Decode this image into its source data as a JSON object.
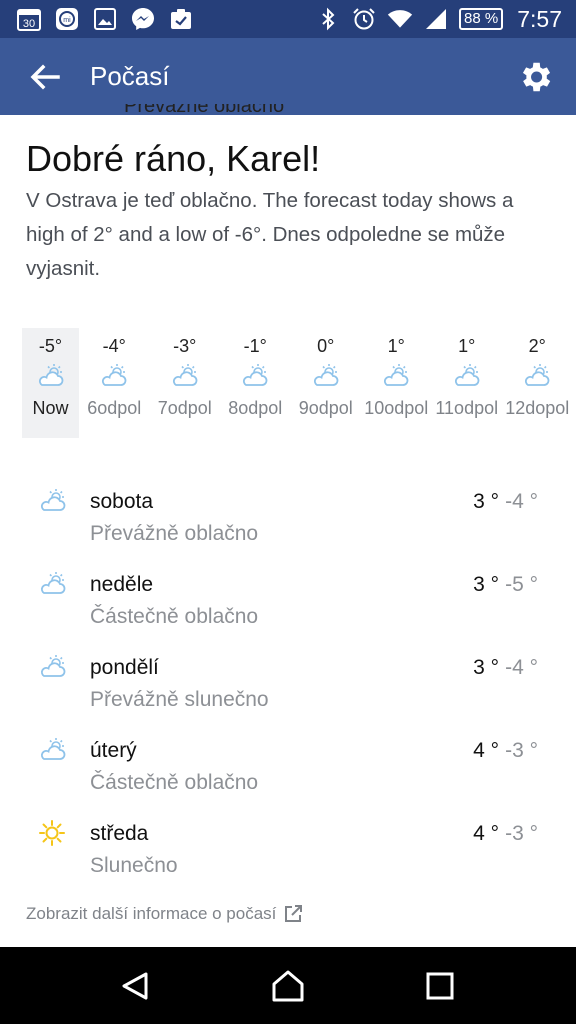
{
  "status_bar": {
    "notification_icons": [
      "calendar-30-icon",
      "mi-fit-icon",
      "gallery-icon",
      "messenger-icon",
      "tasks-icon"
    ],
    "calendar_day": "30",
    "right_icons": [
      "bluetooth-icon",
      "alarm-icon",
      "wifi-icon",
      "signal-icon"
    ],
    "battery": "88 %",
    "time": "7:57"
  },
  "app_bar": {
    "title": "Počasí",
    "color": "#3b5998"
  },
  "cut_off_text": "Převážně oblačno",
  "greeting": "Dobré ráno, Karel!",
  "summary": "V Ostrava je teď oblačno. The forecast today shows a high of 2° and a low of -6°. Dnes odpoledne se může vyjasnit.",
  "hourly": [
    {
      "temp": "-5°",
      "label": "Now",
      "icon": "partly-cloudy-icon"
    },
    {
      "temp": "-4°",
      "label": "6odpol",
      "icon": "partly-cloudy-icon"
    },
    {
      "temp": "-3°",
      "label": "7odpol",
      "icon": "partly-cloudy-icon"
    },
    {
      "temp": "-1°",
      "label": "8odpol",
      "icon": "partly-cloudy-icon"
    },
    {
      "temp": "0°",
      "label": "9odpol",
      "icon": "partly-cloudy-icon"
    },
    {
      "temp": "1°",
      "label": "10odpol",
      "icon": "partly-cloudy-icon"
    },
    {
      "temp": "1°",
      "label": "11odpol",
      "icon": "partly-sunny-icon"
    },
    {
      "temp": "2°",
      "label": "12dopol",
      "icon": "partly-sunny-icon"
    }
  ],
  "daily": [
    {
      "day": "sobota",
      "condition": "Převážně oblačno",
      "high": "3 °",
      "low": "-4 °",
      "icon": "partly-cloudy-icon"
    },
    {
      "day": "neděle",
      "condition": "Částečně oblačno",
      "high": "3 °",
      "low": "-5 °",
      "icon": "partly-cloudy-icon"
    },
    {
      "day": "pondělí",
      "condition": "Převážně slunečno",
      "high": "3 °",
      "low": "-4 °",
      "icon": "partly-sunny-icon"
    },
    {
      "day": "úterý",
      "condition": "Částečně oblačno",
      "high": "4 °",
      "low": "-3 °",
      "icon": "partly-cloudy-icon"
    },
    {
      "day": "středa",
      "condition": "Slunečno",
      "high": "4 °",
      "low": "-3 °",
      "icon": "sun-icon"
    }
  ],
  "more_link": "Zobrazit další informace o počasí",
  "colors": {
    "icon_blue": "#8fc3ea",
    "sun_yellow": "#f5c518",
    "muted_text": "#8d9095"
  }
}
